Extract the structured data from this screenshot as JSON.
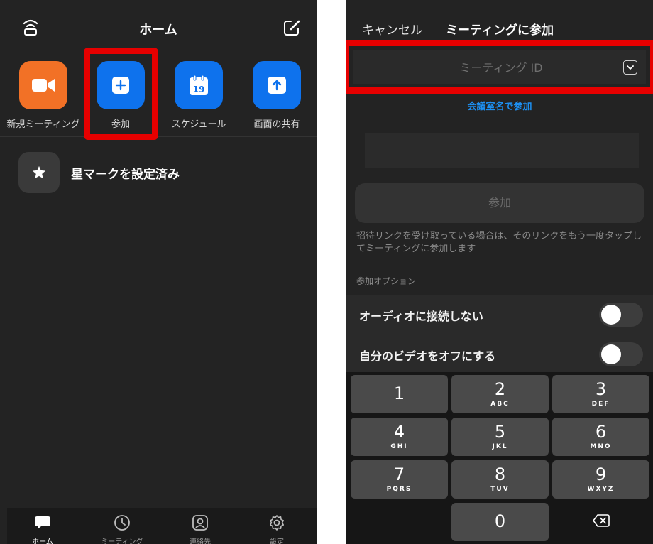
{
  "left": {
    "title": "ホーム",
    "tiles": [
      {
        "label": "新規ミーティング",
        "icon": "video-camera-icon",
        "color": "#f27126"
      },
      {
        "label": "参加",
        "icon": "plus-icon",
        "color": "#0e72ed"
      },
      {
        "label": "スケジュール",
        "icon": "calendar-icon",
        "color": "#0e72ed",
        "day": "19"
      },
      {
        "label": "画面の共有",
        "icon": "upload-arrow-icon",
        "color": "#0e72ed"
      }
    ],
    "starred_label": "星マークを設定済み",
    "tabs": [
      {
        "label": "ホーム",
        "icon": "chat-bubble-icon"
      },
      {
        "label": "ミーティング",
        "icon": "clock-icon"
      },
      {
        "label": "連絡先",
        "icon": "contact-icon"
      },
      {
        "label": "設定",
        "icon": "gear-icon"
      }
    ]
  },
  "right": {
    "cancel": "キャンセル",
    "title": "ミーティングに参加",
    "meeting_id_placeholder": "ミーティング ID",
    "room_join": "会議室名で参加",
    "join_button": "参加",
    "hint": "招待リンクを受け取っている場合は、そのリンクをもう一度タップしてミーティングに参加します",
    "options_header": "参加オプション",
    "options": [
      {
        "label": "オーディオに接続しない",
        "on": false
      },
      {
        "label": "自分のビデオをオフにする",
        "on": false
      }
    ],
    "keys": [
      {
        "num": "1",
        "letters": ""
      },
      {
        "num": "2",
        "letters": "ABC"
      },
      {
        "num": "3",
        "letters": "DEF"
      },
      {
        "num": "4",
        "letters": "GHI"
      },
      {
        "num": "5",
        "letters": "JKL"
      },
      {
        "num": "6",
        "letters": "MNO"
      },
      {
        "num": "7",
        "letters": "PQRS"
      },
      {
        "num": "8",
        "letters": "TUV"
      },
      {
        "num": "9",
        "letters": "WXYZ"
      },
      {
        "num": "0",
        "letters": ""
      }
    ]
  },
  "highlight_color": "#e60000"
}
